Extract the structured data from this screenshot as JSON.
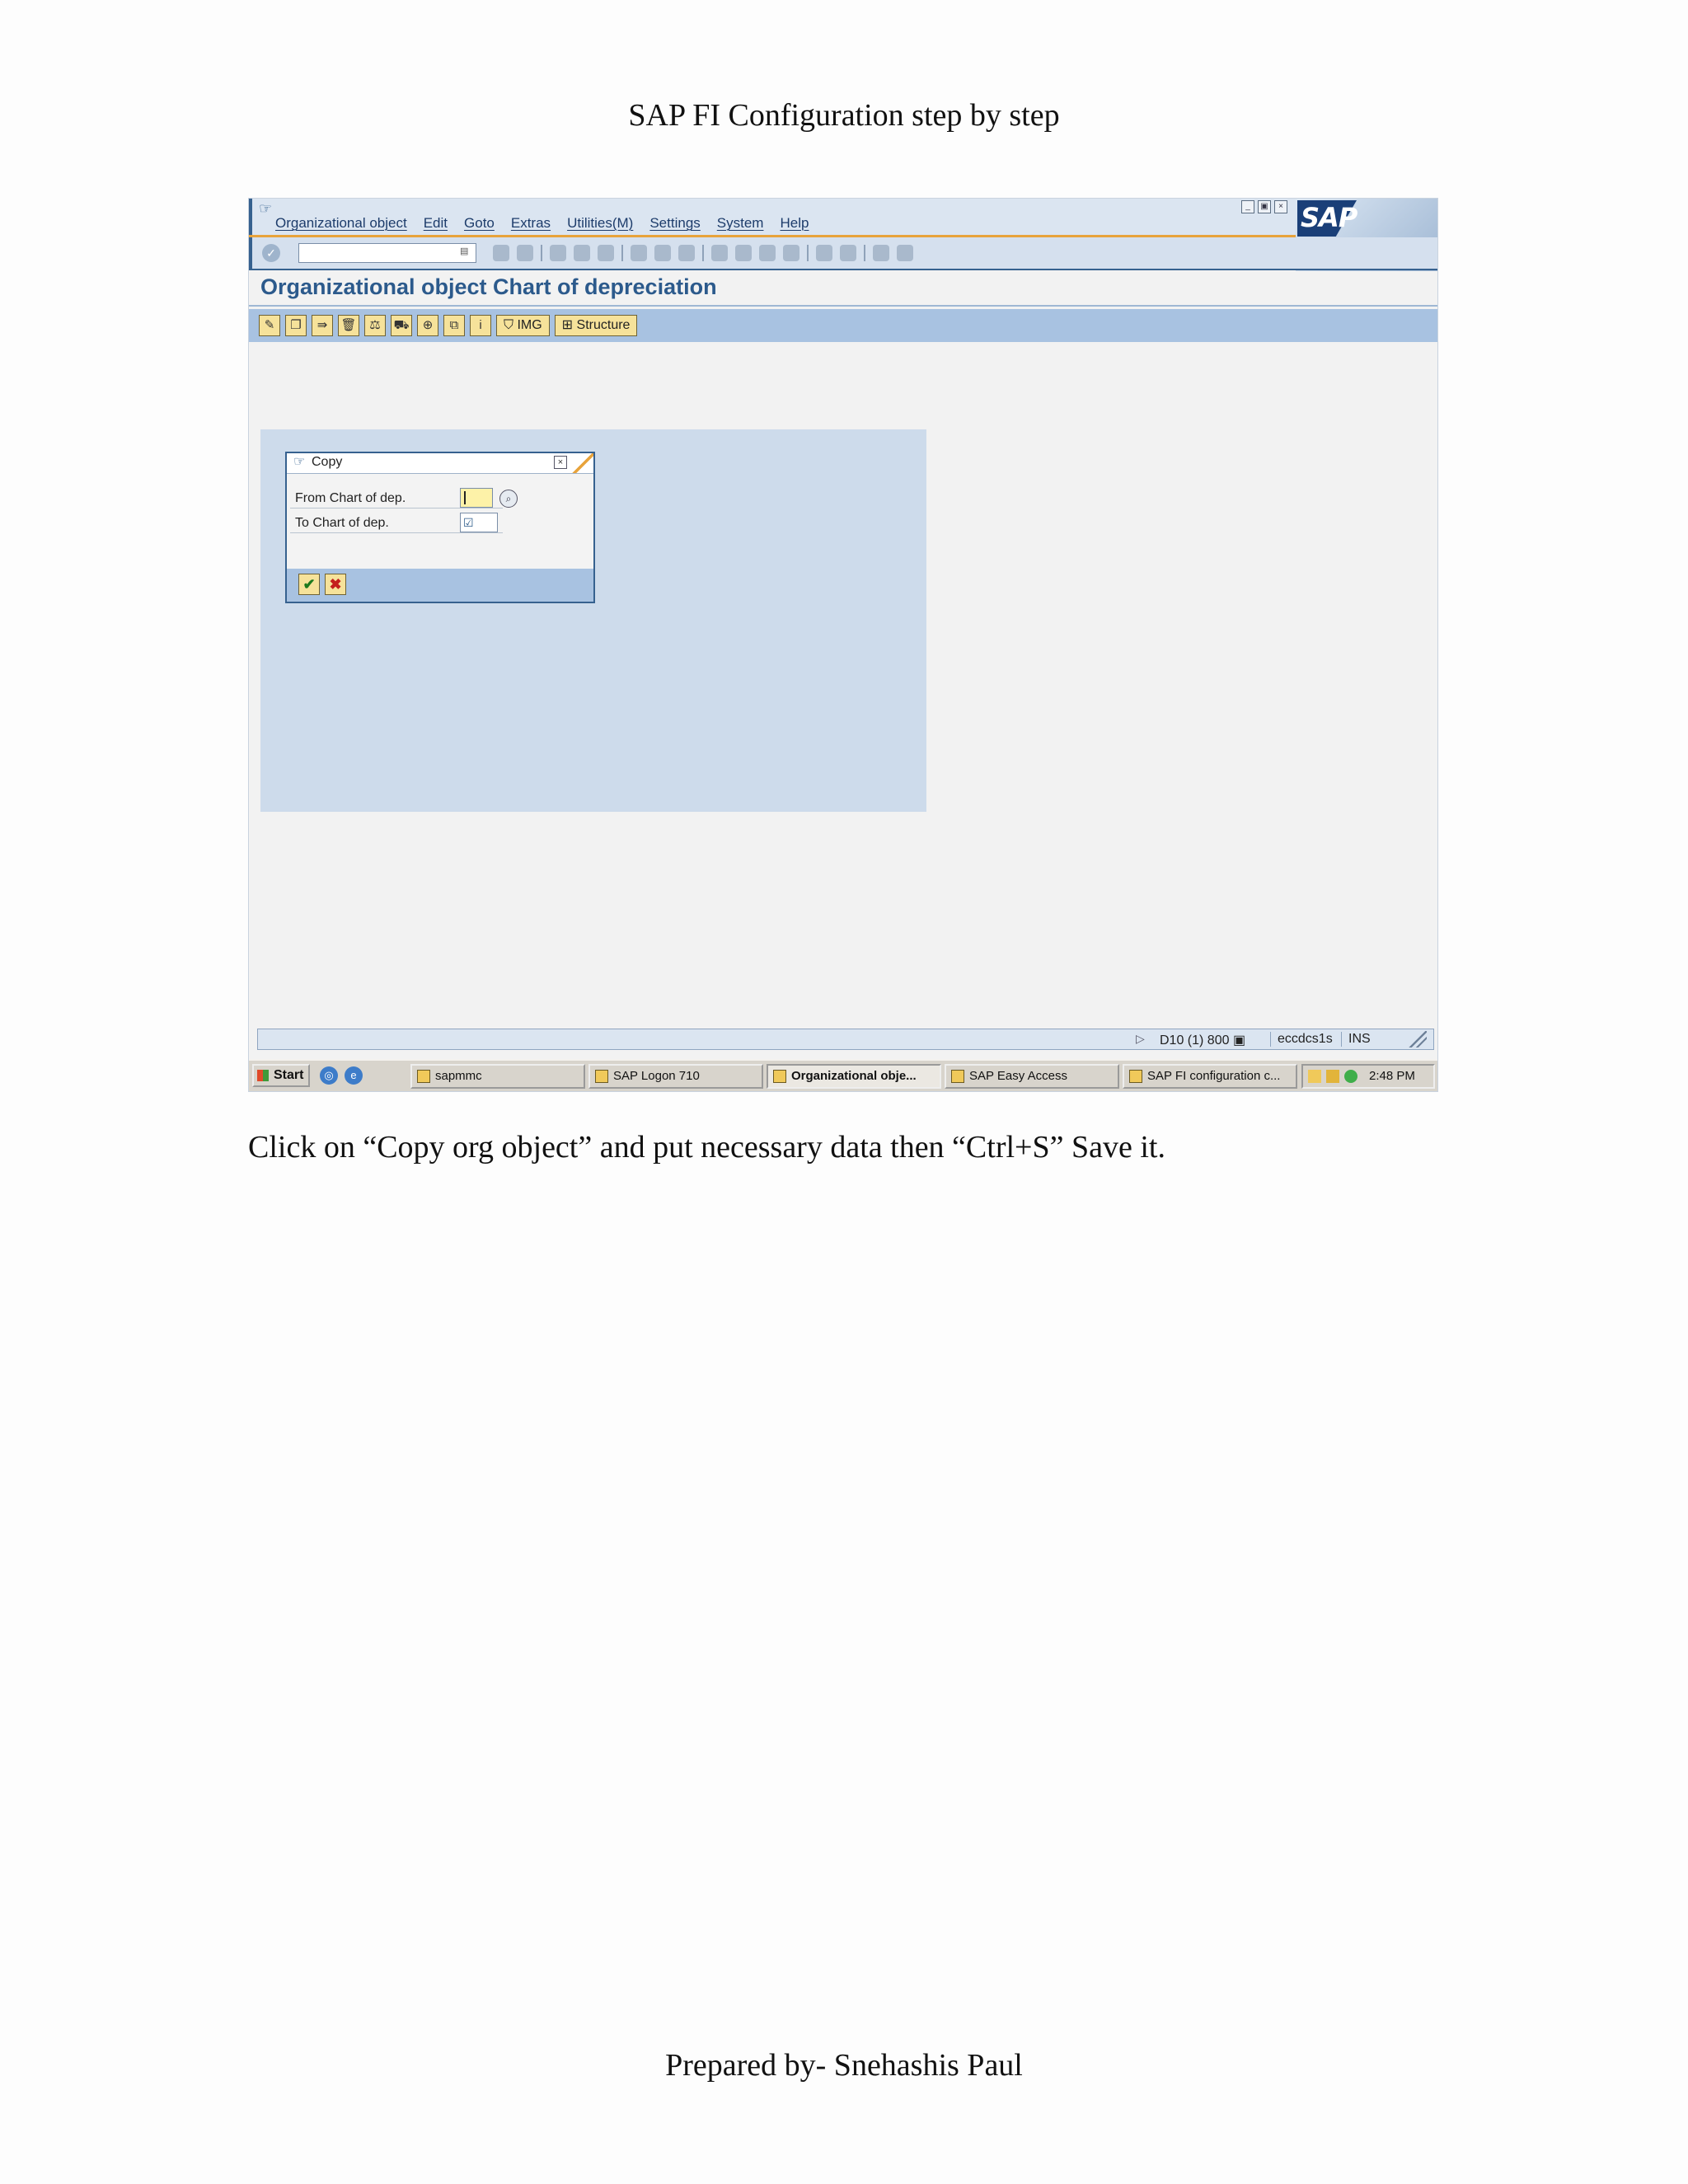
{
  "document": {
    "title": "SAP FI Configuration step by step",
    "caption": "Click on “Copy org object” and put necessary data then “Ctrl+S” Save it.",
    "footer": "Prepared by- Snehashis Paul"
  },
  "sap_window": {
    "menu": [
      "Organizational object",
      "Edit",
      "Goto",
      "Extras",
      "Utilities(M)",
      "Settings",
      "System",
      "Help"
    ],
    "logo_text": "SAP",
    "page_title": "Organizational object Chart of depreciation",
    "app_toolbar": {
      "icons": [
        "edit-icon",
        "copy-icon",
        "copy-org-object-icon",
        "delete-icon",
        "check-icon",
        "transport-icon",
        "target-icon",
        "where-used-icon",
        "info-icon"
      ],
      "img_label": "IMG",
      "structure_label": "Structure"
    },
    "dialog": {
      "title": "Copy",
      "from_label": "From Chart of dep.",
      "to_label": "To Chart of dep.",
      "from_value": "",
      "to_value": ""
    },
    "status": {
      "system": "D10 (1) 800",
      "host": "eccdcs1s",
      "mode": "INS"
    }
  },
  "taskbar": {
    "start": "Start",
    "tasks": [
      "sapmmc",
      "SAP Logon 710",
      "Organizational obje...",
      "SAP Easy Access",
      "SAP FI configuration c..."
    ],
    "active_index": 2,
    "clock": "2:48 PM"
  }
}
